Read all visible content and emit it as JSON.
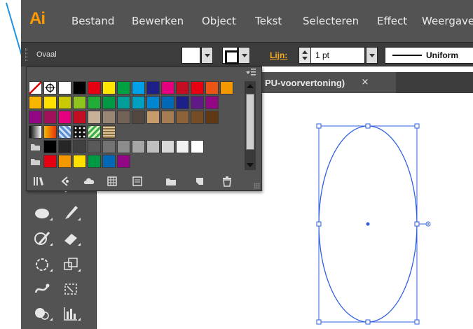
{
  "app": {
    "logo_text": "Ai"
  },
  "menubar": {
    "items": [
      "Bestand",
      "Bewerken",
      "Object",
      "Tekst",
      "Selecteren",
      "Effect",
      "Weergave"
    ]
  },
  "control_bar": {
    "selection_type": "Ovaal",
    "stroke_label": "Lijn:",
    "stroke_weight": "1 pt",
    "profile_label": "Uniform"
  },
  "document_tab": {
    "title": "PU-voorvertoning)",
    "close_symbol": "×"
  },
  "swatches_panel": {
    "rows": [
      [
        "none",
        "registration",
        "#ffffff",
        "#000000",
        "#e50012",
        "#ffe600",
        "#00a140",
        "#00a0e9",
        "#1d2088",
        "#e4007f",
        "#c30d23",
        "#e60012",
        "#ea5514",
        "#f39800"
      ],
      [
        "#f8b500",
        "#ffe100",
        "#c9ca03",
        "#8fc31f",
        "#22ac38",
        "#009944",
        "#009e96",
        "#00a0c1",
        "#0086d1",
        "#0068b7",
        "#1d2088",
        "#601986",
        "#920783"
      ],
      [
        "#920783",
        "#a0105b",
        "#e4007f",
        "#c30d23",
        "#c7b299",
        "#998675",
        "#736357",
        "#534741",
        "#c69c6d",
        "#a67c52",
        "#8c6239",
        "#754c24",
        "#603813"
      ],
      [
        "grad-bw",
        "grad-orange",
        "pattern-blue",
        "pattern-dots",
        "pattern-green",
        "pattern-brown"
      ],
      [
        "folder",
        "#000000",
        "#262626",
        "#404040",
        "#595959",
        "#737373",
        "#8c8c8c",
        "#a6a6a6",
        "#bfbfbf",
        "#d9d9d9",
        "#f2f2f2",
        "#ffffff"
      ],
      [
        "folder",
        "#e60012",
        "#f39800",
        "#ffe100",
        "#009944",
        "#0068b7",
        "#920783"
      ]
    ],
    "bottom_icons": [
      "library-icon",
      "swatch-kinds-icon",
      "cloud-sync-icon",
      "swatch-options-icon",
      "list-view-icon",
      "folder-icon",
      "new-swatch-icon",
      "trash-icon"
    ]
  },
  "colors": {
    "accent": "#f6a91b",
    "logo": "#ff9a00",
    "selection": "#2e5fe3",
    "annotation": "#1e90e6"
  }
}
